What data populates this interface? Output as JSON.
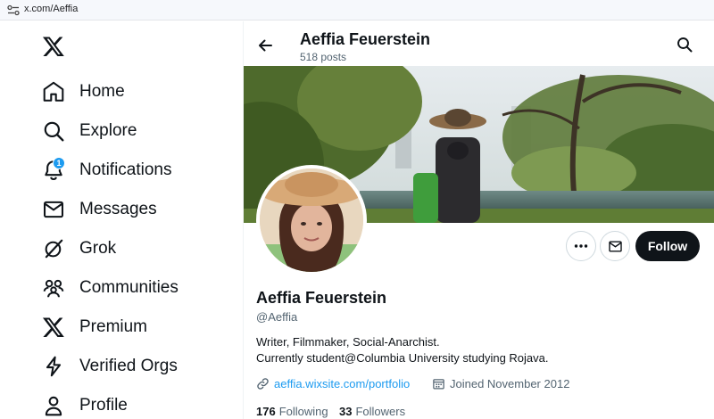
{
  "browser": {
    "url": "x.com/Aeffia",
    "site_info_icon": "site-settings-icon"
  },
  "nav": {
    "logo_icon": "x-logo-icon",
    "items": [
      {
        "label": "Home",
        "icon": "home-icon"
      },
      {
        "label": "Explore",
        "icon": "search-icon"
      },
      {
        "label": "Notifications",
        "icon": "bell-icon",
        "badge": "1"
      },
      {
        "label": "Messages",
        "icon": "envelope-icon"
      },
      {
        "label": "Grok",
        "icon": "grok-icon"
      },
      {
        "label": "Communities",
        "icon": "people-icon"
      },
      {
        "label": "Premium",
        "icon": "x-logo-icon"
      },
      {
        "label": "Verified Orgs",
        "icon": "lightning-icon"
      },
      {
        "label": "Profile",
        "icon": "person-icon"
      }
    ]
  },
  "header": {
    "name": "Aeffia Feuerstein",
    "posts": "518 posts"
  },
  "profile": {
    "name": "Aeffia Feuerstein",
    "handle": "@Aeffia",
    "bio_line1": "Writer, Filmmaker, Social-Anarchist.",
    "bio_line2": "Currently student@Columbia University studying Rojava.",
    "website": "aeffia.wixsite.com/portfolio",
    "joined": "Joined November 2012",
    "following_count": "176",
    "following_label": "Following",
    "followers_count": "33",
    "followers_label": "Followers"
  },
  "actions": {
    "follow_label": "Follow"
  },
  "colors": {
    "accent": "#1d9bf0",
    "text": "#0f1419",
    "muted": "#536471",
    "follow_bg": "#0f1419"
  }
}
